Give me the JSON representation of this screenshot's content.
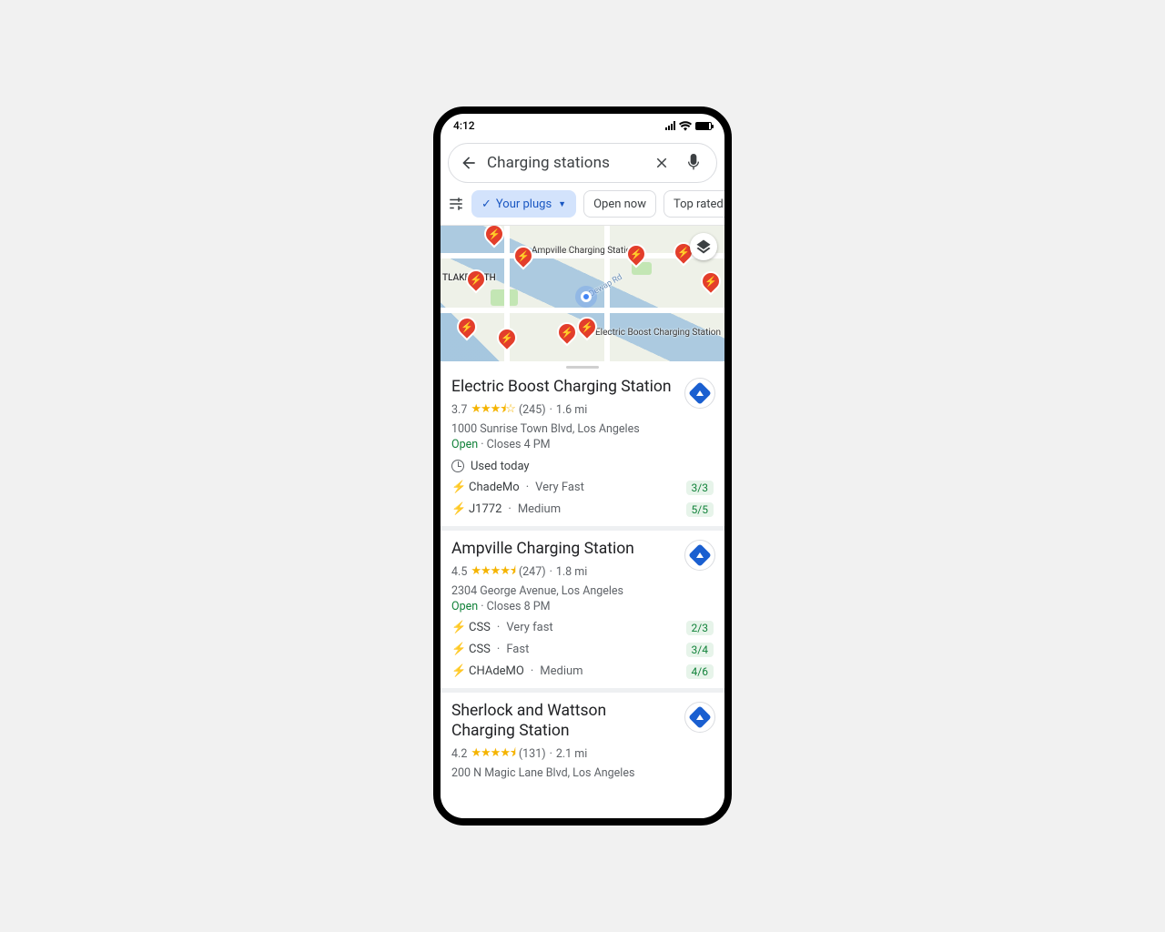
{
  "status": {
    "time": "4:12"
  },
  "search": {
    "query": "Charging stations"
  },
  "filters": {
    "your_plugs": "Your plugs",
    "open_now": "Open now",
    "top_rated": "Top rated"
  },
  "map": {
    "labels": {
      "ampville": "Ampville Charging\nStation",
      "electric": "Electric Boost\nCharging Station",
      "westlake": "TLAKE\nORTH",
      "dewap": "Dewap Rd"
    }
  },
  "results": [
    {
      "name": "Electric Boost Charging Station",
      "rating": "3.7",
      "stars": "★★★⯨☆",
      "reviews": "(245)",
      "distance": "1.6 mi",
      "address": "1000 Sunrise Town Blvd, Los Angeles",
      "open": "Open",
      "closes": "Closes 4 PM",
      "used": "Used today",
      "connectors": [
        {
          "type": "ChadeMo",
          "speed": "Very Fast",
          "avail": "3/3"
        },
        {
          "type": "J1772",
          "speed": "Medium",
          "avail": "5/5"
        }
      ]
    },
    {
      "name": "Ampville Charging Station",
      "rating": "4.5",
      "stars": "★★★★⯨",
      "reviews": "(247)",
      "distance": "1.8 mi",
      "address": "2304 George Avenue, Los Angeles",
      "open": "Open",
      "closes": "Closes 8 PM",
      "connectors": [
        {
          "type": "CSS",
          "speed": "Very fast",
          "avail": "2/3"
        },
        {
          "type": "CSS",
          "speed": "Fast",
          "avail": "3/4"
        },
        {
          "type": "CHAdeMO",
          "speed": "Medium",
          "avail": "4/6"
        }
      ]
    },
    {
      "name": "Sherlock and Wattson Charging Station",
      "rating": "4.2",
      "stars": "★★★★⯨",
      "reviews": "(131)",
      "distance": "2.1 mi",
      "address": "200 N Magic Lane Blvd, Los Angeles"
    }
  ]
}
